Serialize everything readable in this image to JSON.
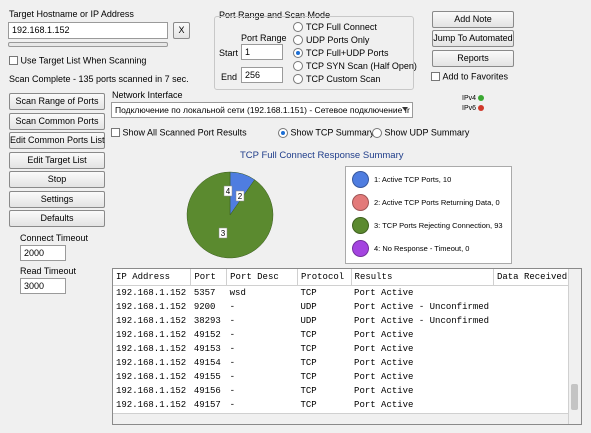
{
  "target": {
    "label": "Target Hostname or IP Address",
    "value": "192.168.1.152",
    "clear_label": "X",
    "use_list_label": "Use Target List When Scanning"
  },
  "status": "Scan Complete - 135 ports scanned in 7 sec.",
  "port_range": {
    "group_label": "Port Range and Scan Mode",
    "range_label": "Port Range",
    "start_label": "Start",
    "start_value": "1",
    "end_label": "End",
    "end_value": "256",
    "modes": [
      "TCP Full Connect",
      "UDP Ports Only",
      "TCP Full+UDP Ports",
      "TCP SYN Scan (Half Open)",
      "TCP Custom Scan"
    ],
    "selected_mode": "TCP Full+UDP Ports"
  },
  "right_buttons": {
    "add_note": "Add Note",
    "jump": "Jump To Automated",
    "reports": "Reports",
    "favorites_label": "Add to Favorites"
  },
  "left_buttons": [
    "Scan Range of Ports",
    "Scan Common Ports",
    "Edit Common Ports List",
    "Edit Target List",
    "Stop",
    "Settings",
    "Defaults"
  ],
  "timeouts": {
    "connect_label": "Connect Timeout",
    "connect_value": "2000",
    "read_label": "Read Timeout",
    "read_value": "3000"
  },
  "network": {
    "label": "Network Interface",
    "value": "Подключение по локальной сети (192.168.1.151) - Сетевое подключение Ir",
    "ipv4": "IPv4",
    "ipv6": "IPv6",
    "ipv4_color": "#3aa832",
    "ipv6_color": "#d0392b"
  },
  "options": {
    "show_all_label": "Show All Scanned Port Results",
    "tcp_summary_label": "Show TCP Summary",
    "udp_summary_label": "Show UDP Summary"
  },
  "chart_data": {
    "type": "pie",
    "title": "TCP Full Connect Response Summary",
    "slices": [
      {
        "label": "1",
        "name": "Active TCP Ports",
        "value": 10,
        "color": "#4f7de0"
      },
      {
        "label": "2",
        "name": "Active TCP Ports Returning Data",
        "value": 0,
        "color": "#e37a7a"
      },
      {
        "label": "3",
        "name": "TCP Ports Rejecting Connection",
        "value": 93,
        "color": "#5b8a2f"
      },
      {
        "label": "4",
        "name": "No Response - Timeout",
        "value": 0,
        "color": "#a444e0"
      }
    ]
  },
  "legend_items": [
    "1: Active TCP Ports, 10",
    "2: Active TCP Ports Returning Data, 0",
    "3: TCP Ports Rejecting Connection, 93",
    "4: No Response - Timeout, 0"
  ],
  "table": {
    "columns": [
      "IP Address",
      "Port",
      "Port Desc",
      "Protocol",
      "Results",
      "Data Received"
    ],
    "rows": [
      [
        "192.168.1.152",
        "5357",
        "wsd",
        "TCP",
        "Port Active",
        ""
      ],
      [
        "192.168.1.152",
        "9200",
        "-",
        "UDP",
        "Port Active - Unconfirmed",
        ""
      ],
      [
        "192.168.1.152",
        "38293",
        "-",
        "UDP",
        "Port Active - Unconfirmed",
        ""
      ],
      [
        "192.168.1.152",
        "49152",
        "-",
        "TCP",
        "Port Active",
        ""
      ],
      [
        "192.168.1.152",
        "49153",
        "-",
        "TCP",
        "Port Active",
        ""
      ],
      [
        "192.168.1.152",
        "49154",
        "-",
        "TCP",
        "Port Active",
        ""
      ],
      [
        "192.168.1.152",
        "49155",
        "-",
        "TCP",
        "Port Active",
        ""
      ],
      [
        "192.168.1.152",
        "49156",
        "-",
        "TCP",
        "Port Active",
        ""
      ],
      [
        "192.168.1.152",
        "49157",
        "-",
        "TCP",
        "Port Active",
        ""
      ]
    ]
  }
}
